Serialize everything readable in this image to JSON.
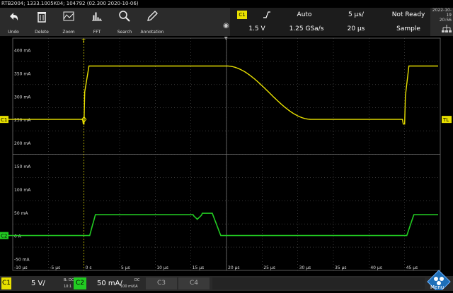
{
  "title": "RTB2004; 1333.1005K04; 104792 (02.300 2020-10-06)",
  "toolbar": [
    {
      "label": "Undo",
      "icon": "undo-icon"
    },
    {
      "label": "Delete",
      "icon": "delete-icon"
    },
    {
      "label": "Zoom",
      "icon": "zoom-icon"
    },
    {
      "label": "FFT",
      "icon": "fft-icon"
    },
    {
      "label": "Search",
      "icon": "search-icon"
    },
    {
      "label": "Annotation",
      "icon": "annotation-icon"
    }
  ],
  "settings": {
    "trigger_channel": "C1",
    "trigger_level": "1.5 V",
    "trigger_slope_icon": "rising-edge-icon",
    "trigger_mode": "Auto",
    "sample_rate": "1.25 GSa/s",
    "timebase": "5 µs/",
    "record_length": "20 µs",
    "status": "Not Ready",
    "acquisition": "Sample"
  },
  "clock": {
    "date": "2022-10-19",
    "time": "20:56"
  },
  "grid": {
    "y_labels": [
      "400 mA",
      "350 mA",
      "300 mA",
      "250 mA",
      "200 mA",
      "150 mA",
      "100 mA",
      "50 mA",
      "0 A",
      "-50 mA"
    ],
    "x_labels": [
      "-10 µs",
      "-5 µs",
      "0 s",
      "5 µs",
      "10 µs",
      "15 µs",
      "20 µs",
      "25 µs",
      "30 µs",
      "35 µs",
      "40 µs",
      "45 µs"
    ],
    "trigger_marker": "T",
    "tl_marker": "TL",
    "c1_marker": "C1",
    "c2_marker": "C2"
  },
  "channels": [
    {
      "name": "C1",
      "scale": "5 V/",
      "coupling": "B₁ DC",
      "probe": "10:1",
      "color": "#e8e000"
    },
    {
      "name": "C2",
      "scale": "50 mA/",
      "coupling": "DC",
      "probe": "100 mV/A",
      "color": "#22cc22"
    },
    {
      "name": "C3",
      "scale": "",
      "color": "#888888"
    },
    {
      "name": "C4",
      "scale": "",
      "color": "#888888"
    }
  ],
  "menu_label": "Menu",
  "colors": {
    "ch1": "#e8e000",
    "ch2": "#22cc22",
    "grid": "#5a5a5a",
    "bg": "#000000"
  }
}
